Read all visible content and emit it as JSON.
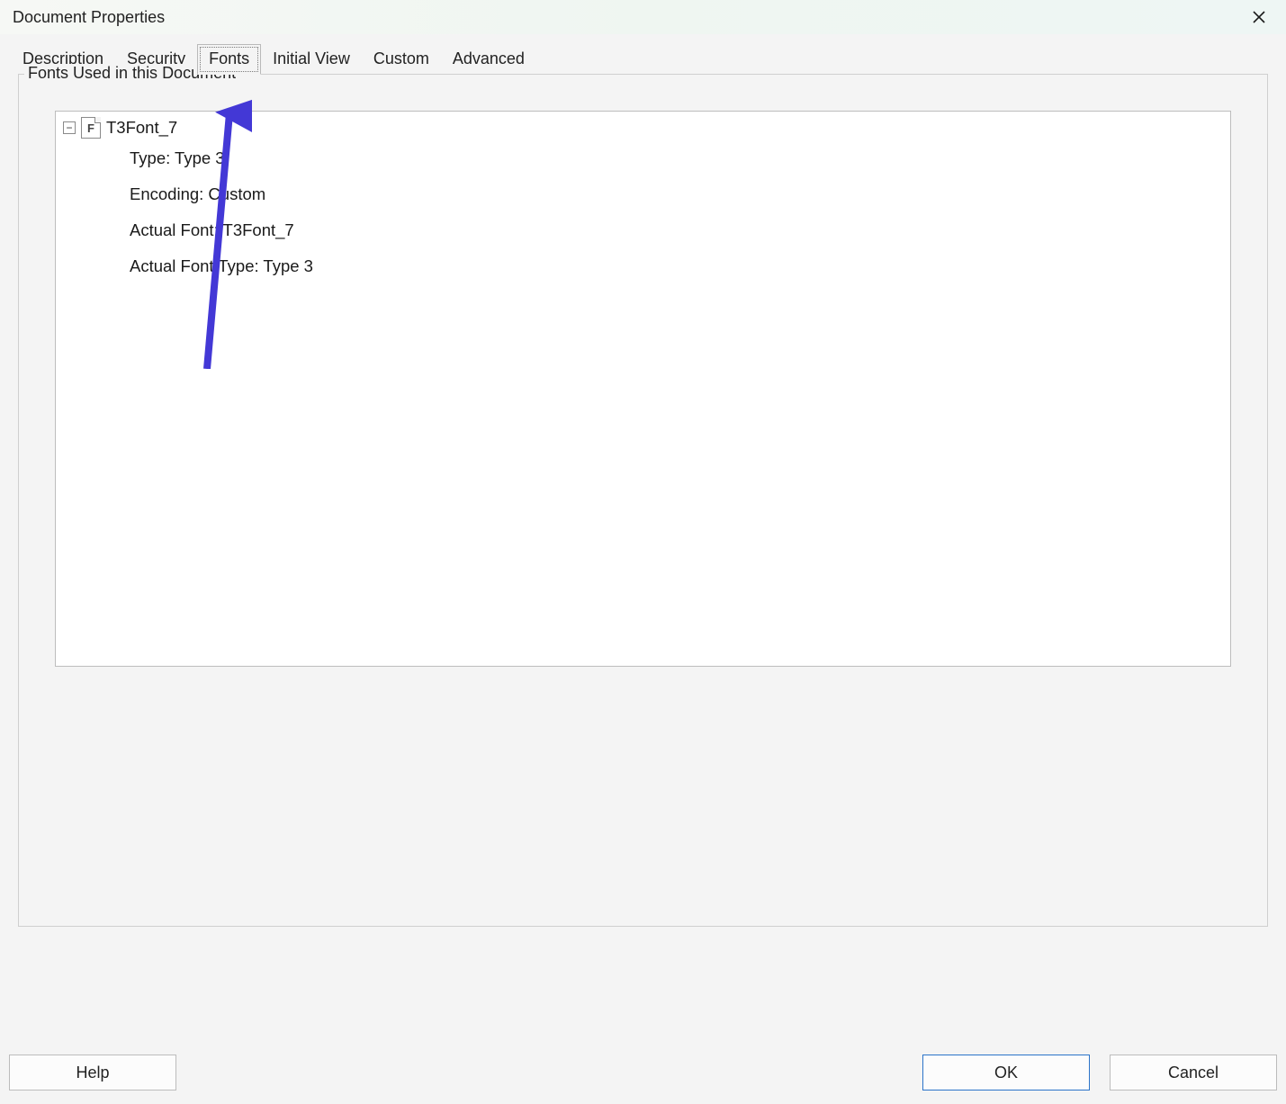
{
  "window": {
    "title": "Document Properties"
  },
  "tabs": {
    "description": "Description",
    "security": "Security",
    "fonts": "Fonts",
    "initial_view": "Initial View",
    "custom": "Custom",
    "advanced": "Advanced"
  },
  "panel": {
    "legend": "Fonts Used in this Document"
  },
  "font_tree": {
    "toggle_glyph": "−",
    "icon_letter": "F",
    "name": "T3Font_7",
    "children": {
      "type": "Type: Type 3",
      "encoding": "Encoding: Custom",
      "actual_font": "Actual Font: T3Font_7",
      "actual_font_type": "Actual Font Type: Type 3"
    }
  },
  "buttons": {
    "help": "Help",
    "ok": "OK",
    "cancel": "Cancel"
  },
  "annotation": {
    "arrow_color": "#4338d6"
  }
}
